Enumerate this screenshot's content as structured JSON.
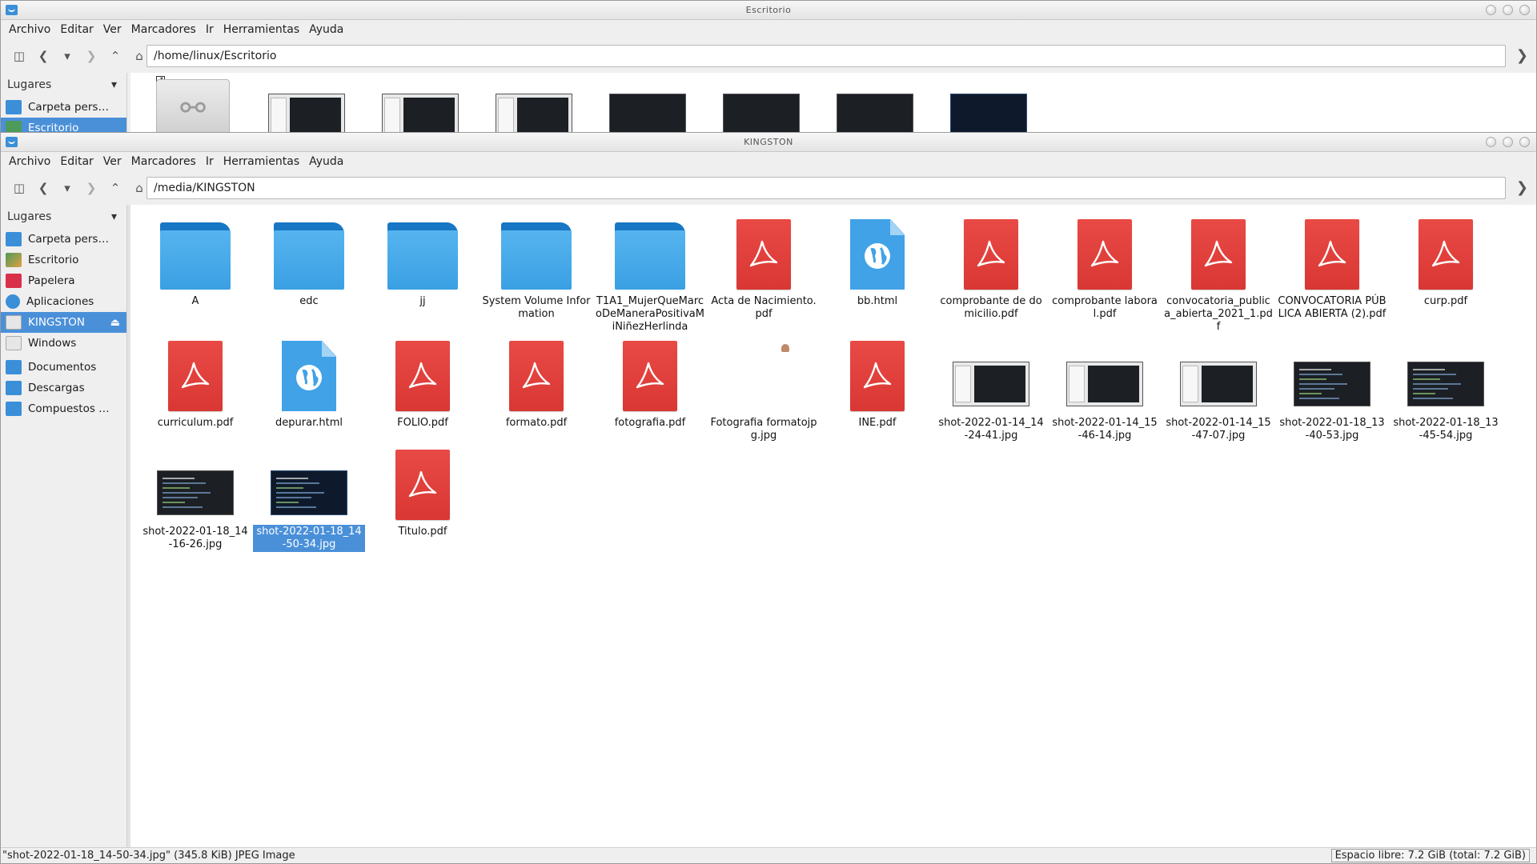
{
  "back_window": {
    "title": "Escritorio",
    "menu": [
      "Archivo",
      "Editar",
      "Ver",
      "Marcadores",
      "Ir",
      "Herramientas",
      "Ayuda"
    ],
    "path": "/home/linux/Escritorio",
    "sidebar_header": "Lugares",
    "sidebar_items": [
      {
        "label": "Carpeta pers…",
        "icon": "home-folder-icon"
      },
      {
        "label": "Escritorio",
        "icon": "desktop-icon",
        "active": true
      }
    ]
  },
  "front_window": {
    "title": "KINGSTON",
    "menu": [
      "Archivo",
      "Editar",
      "Ver",
      "Marcadores",
      "Ir",
      "Herramientas",
      "Ayuda"
    ],
    "path": "/media/KINGSTON",
    "sidebar_header": "Lugares",
    "sidebar_items": [
      {
        "label": "Carpeta pers…",
        "icon": "home-folder-icon",
        "color": "#3b8fd8"
      },
      {
        "label": "Escritorio",
        "icon": "desktop-icon",
        "color": "#4e9a5a"
      },
      {
        "label": "Papelera",
        "icon": "trash-icon",
        "color": "#d9304a"
      },
      {
        "label": "Aplicaciones",
        "icon": "applications-icon",
        "color": "#3b8fd8"
      },
      {
        "label": "KINGSTON",
        "icon": "usb-drive-icon",
        "color": "#dcdcdc",
        "active": true
      },
      {
        "label": "Windows",
        "icon": "drive-icon",
        "color": "#dcdcdc"
      },
      {
        "label": "Documentos",
        "icon": "documents-folder-icon",
        "color": "#3b8fd8"
      },
      {
        "label": "Descargas",
        "icon": "downloads-folder-icon",
        "color": "#3b8fd8"
      },
      {
        "label": "Compuestos …",
        "icon": "folder-icon",
        "color": "#3b8fd8"
      }
    ],
    "files": [
      {
        "name": "A",
        "type": "folder"
      },
      {
        "name": "edc",
        "type": "folder"
      },
      {
        "name": "jj",
        "type": "folder"
      },
      {
        "name": "System Volume Information",
        "type": "folder"
      },
      {
        "name": "T1A1_MujerQueMarcoDeManeraPositivaMiNiñezHerlinda",
        "type": "folder"
      },
      {
        "name": "Acta de Nacimiento.pdf",
        "type": "pdf"
      },
      {
        "name": "bb.html",
        "type": "html"
      },
      {
        "name": "comprobante de domicilio.pdf",
        "type": "pdf"
      },
      {
        "name": "comprobante laboral.pdf",
        "type": "pdf"
      },
      {
        "name": "convocatoria_publica_abierta_2021_1.pdf",
        "type": "pdf"
      },
      {
        "name": "CONVOCATORIA PÚBLICA ABIERTA (2).pdf",
        "type": "pdf"
      },
      {
        "name": "curp.pdf",
        "type": "pdf"
      },
      {
        "name": "curriculum.pdf",
        "type": "pdf"
      },
      {
        "name": "depurar.html",
        "type": "html"
      },
      {
        "name": "FOLIO.pdf",
        "type": "pdf"
      },
      {
        "name": "formato.pdf",
        "type": "pdf"
      },
      {
        "name": "fotografia.pdf",
        "type": "pdf"
      },
      {
        "name": "Fotografia formatojpg.jpg",
        "type": "small-image"
      },
      {
        "name": "INE.pdf",
        "type": "pdf"
      },
      {
        "name": "shot-2022-01-14_14-24-41.jpg",
        "type": "thumb-light"
      },
      {
        "name": "shot-2022-01-14_15-46-14.jpg",
        "type": "thumb-light"
      },
      {
        "name": "shot-2022-01-14_15-47-07.jpg",
        "type": "thumb-light"
      },
      {
        "name": "shot-2022-01-18_13-40-53.jpg",
        "type": "thumb-dark"
      },
      {
        "name": "shot-2022-01-18_13-45-54.jpg",
        "type": "thumb-dark"
      },
      {
        "name": "shot-2022-01-18_14-16-26.jpg",
        "type": "thumb-dark"
      },
      {
        "name": "shot-2022-01-18_14-50-34.jpg",
        "type": "thumb-dark2",
        "selected": true
      },
      {
        "name": "Titulo.pdf",
        "type": "pdf"
      }
    ],
    "status_text": "\"shot-2022-01-18_14-50-34.jpg\" (345.8 KiB) JPEG Image",
    "free_space": "Espacio libre: 7.2 GiB (total: 7.2 GiB)"
  },
  "colors": {
    "accent": "#4a90d9",
    "pdf_red": "#e03e3a",
    "folder_blue": "#3aa0e3"
  }
}
